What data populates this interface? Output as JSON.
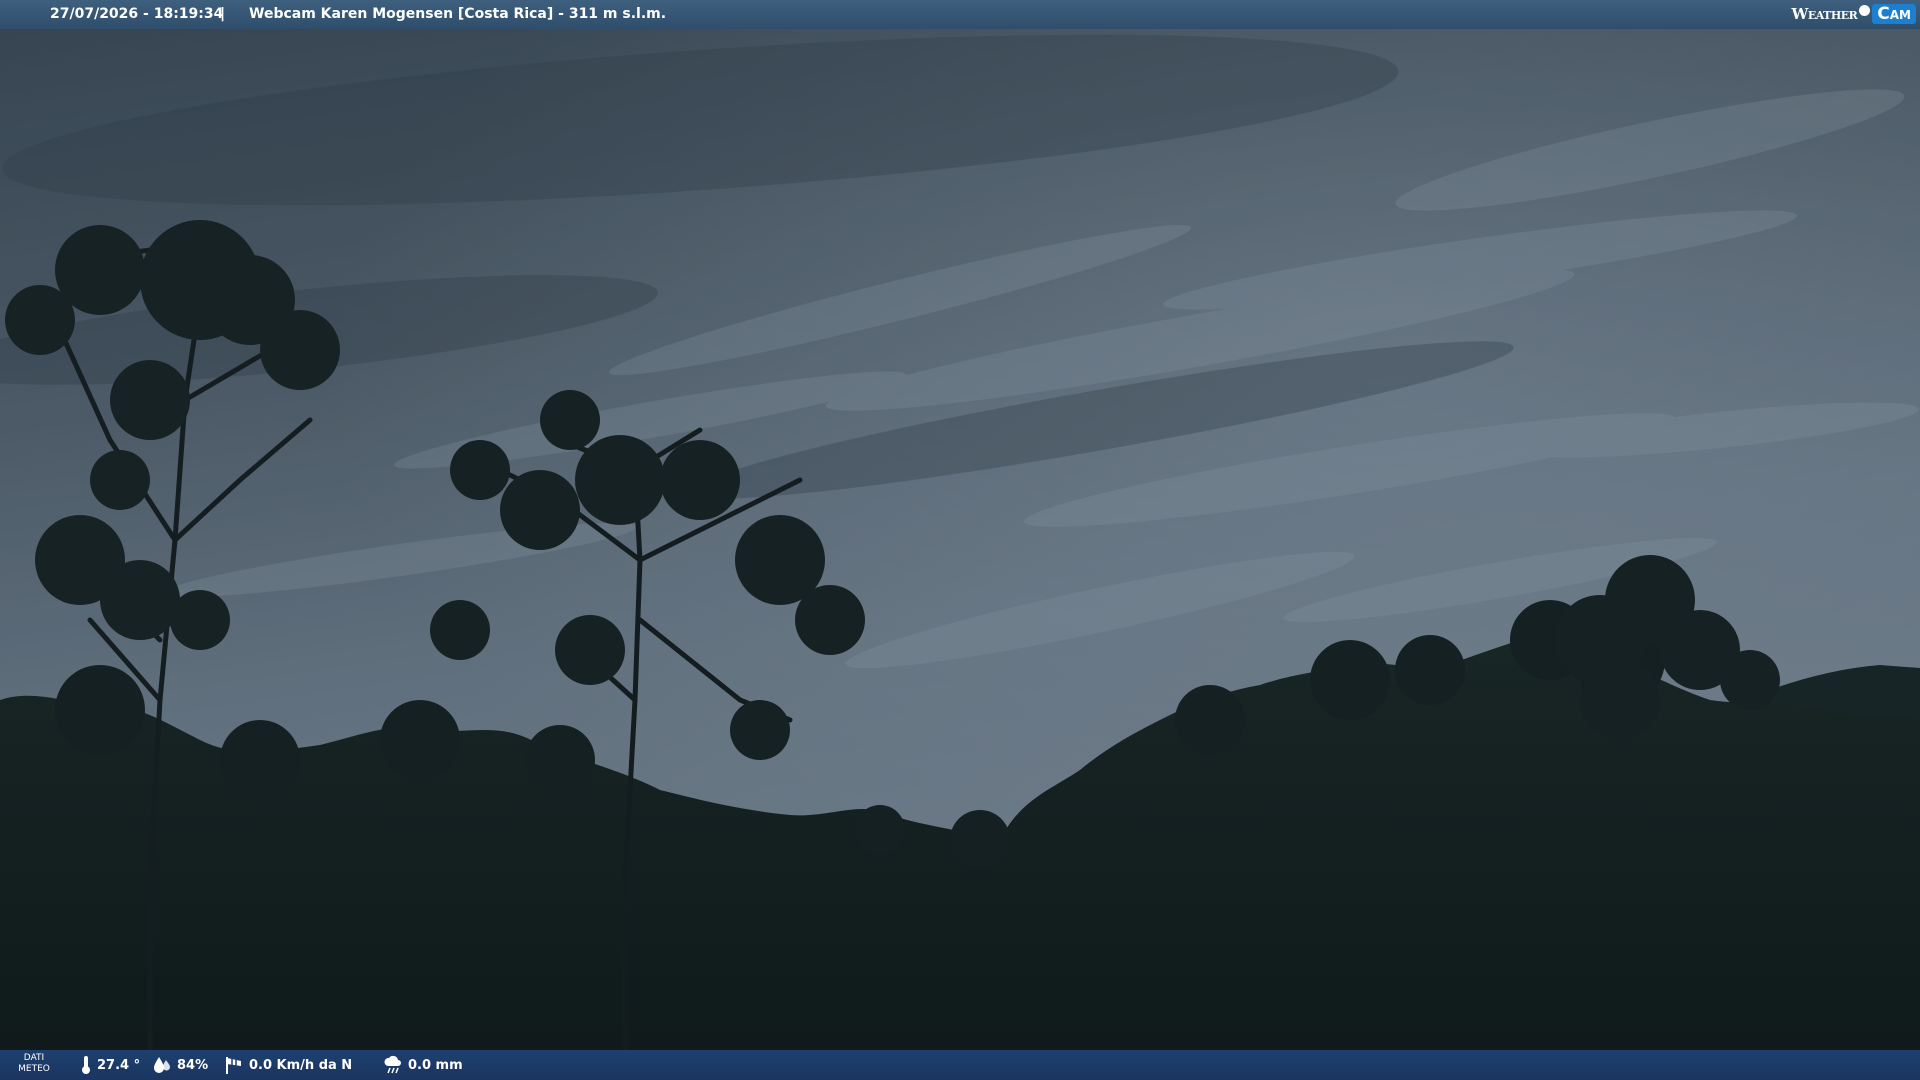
{
  "topbar": {
    "datetime": "27/07/2026 - 18:19:34",
    "separator": "|",
    "location": "Webcam Karen Mogensen [Costa Rica]  -  311 m s.l.m.",
    "logo_weather": "Weather",
    "logo_cam": "Cam"
  },
  "bottombar": {
    "dati_line1": "DATI",
    "dati_line2": "METEO",
    "temperature": "27.4 °",
    "humidity": "84%",
    "wind": "0.0 Km/h da N",
    "rain": "0.0 mm"
  },
  "icons": [
    "thermometer-icon",
    "humidity-drops-icon",
    "wind-sock-icon",
    "rain-cloud-icon"
  ],
  "colors": {
    "topbar": "#3a5a78",
    "bottombar": "#1e3f6c",
    "logo_accent": "#1c7fd0",
    "sky_top": "#3e4e5d",
    "sky_bottom": "#7a8a98",
    "foliage": "#111d1c"
  }
}
